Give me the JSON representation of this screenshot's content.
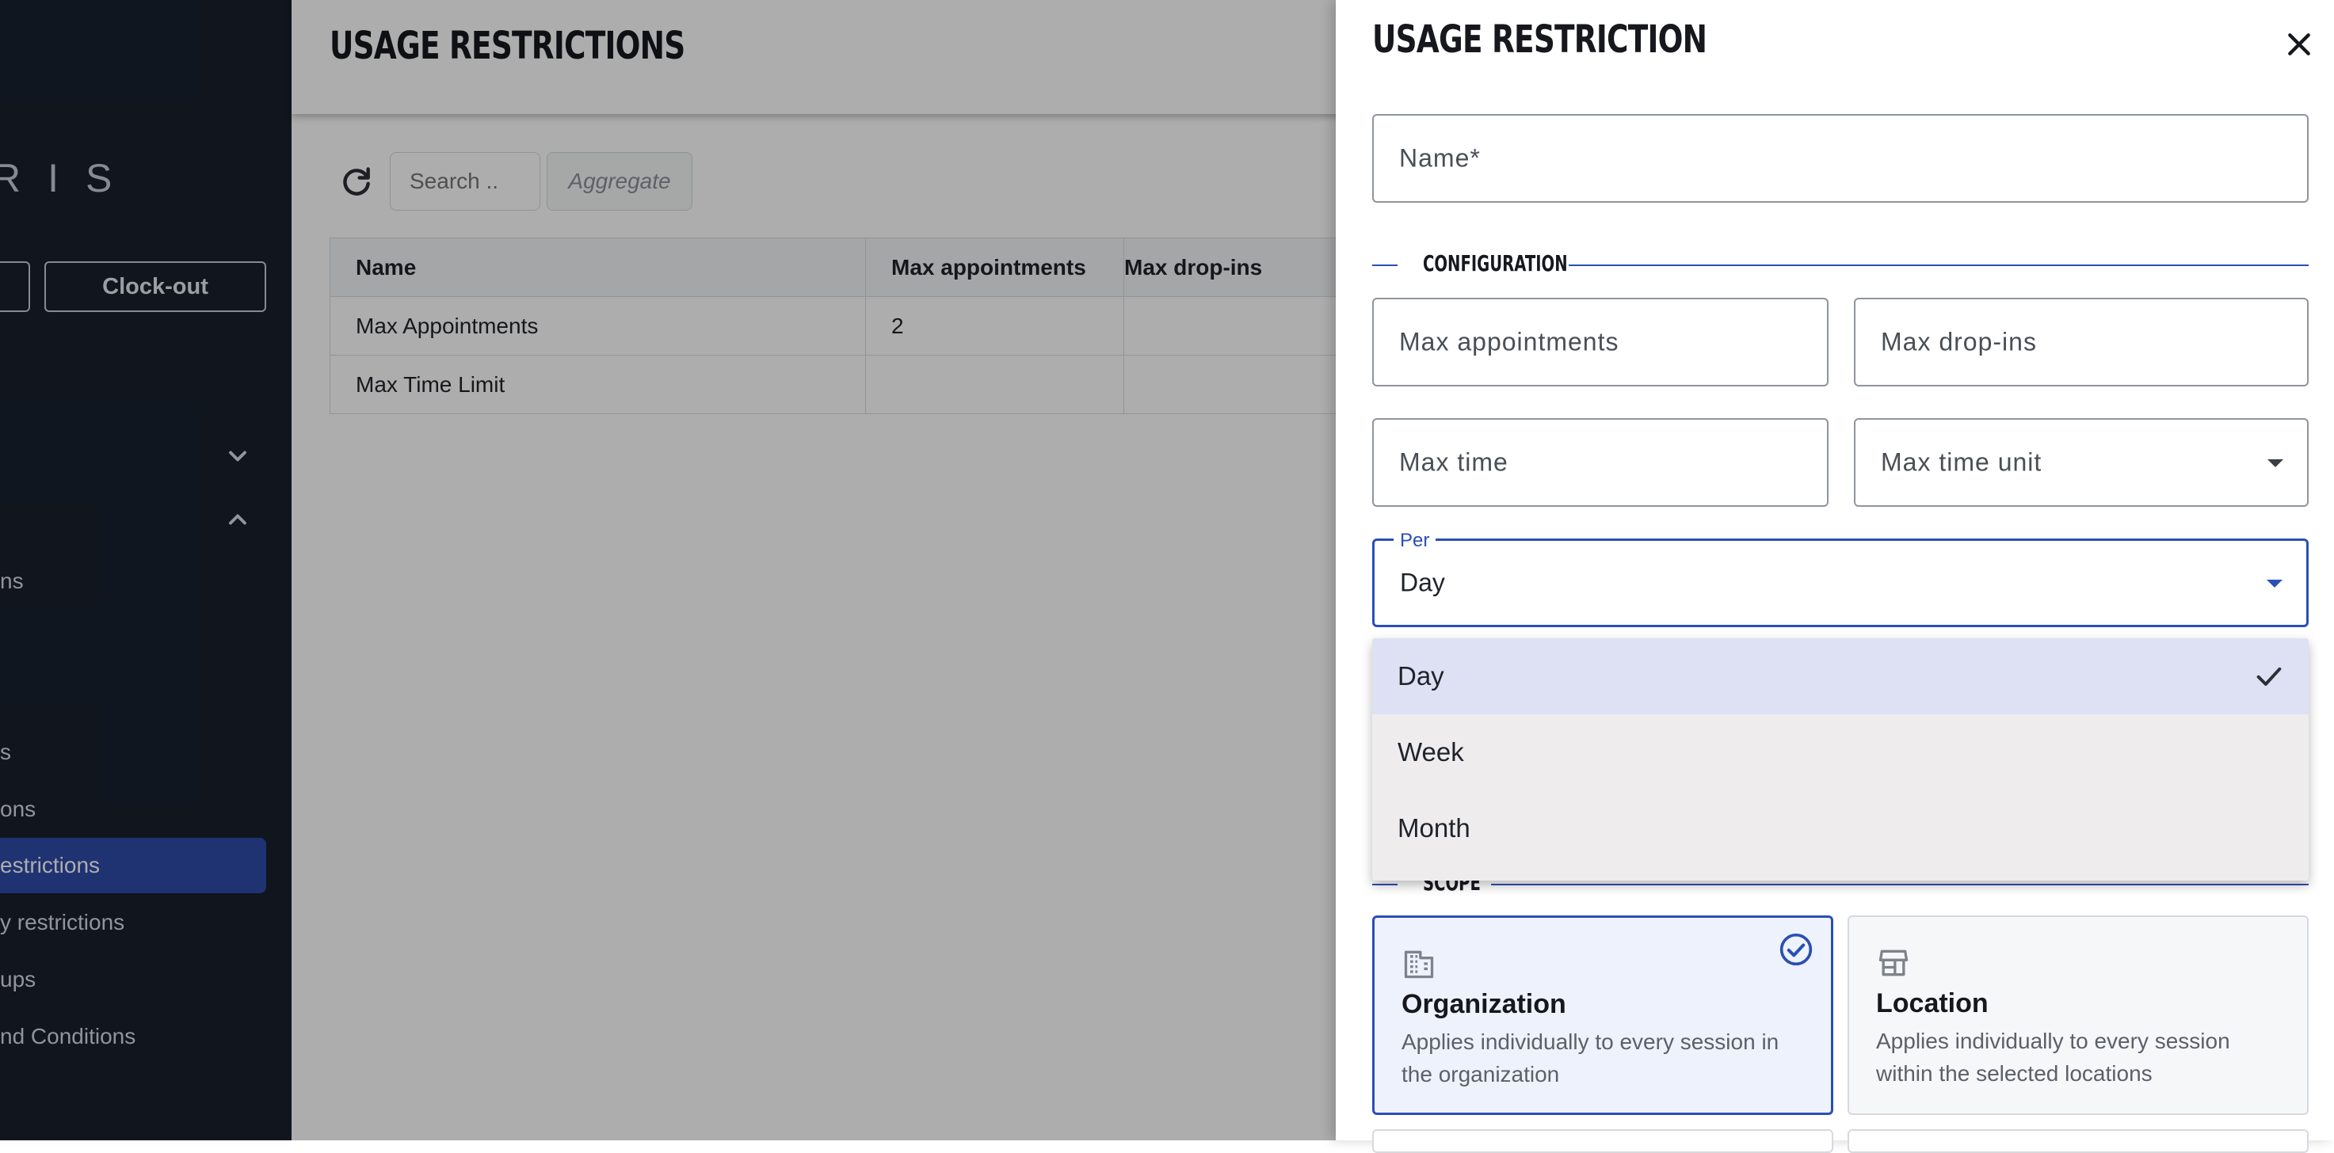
{
  "sidebar": {
    "logo": "RIS",
    "clockout_label": "Clock-out",
    "items": [
      {
        "label": "ns"
      },
      {
        "label": "s"
      },
      {
        "label": "ons"
      },
      {
        "label": "estrictions"
      },
      {
        "label": "y restrictions"
      },
      {
        "label": "ups"
      },
      {
        "label": "nd Conditions"
      }
    ]
  },
  "page": {
    "title": "USAGE RESTRICTIONS",
    "search_placeholder": "Search ..",
    "aggregate_label": "Aggregate",
    "table": {
      "headers": [
        "Name",
        "Max appointments",
        "Max drop-ins"
      ],
      "rows": [
        [
          "Max Appointments",
          "2",
          ""
        ],
        [
          "Max Time Limit",
          "",
          ""
        ]
      ]
    }
  },
  "drawer": {
    "title": "USAGE RESTRICTION",
    "name_placeholder": "Name*",
    "config_section": "CONFIGURATION",
    "max_appointments_placeholder": "Max appointments",
    "max_dropins_placeholder": "Max drop-ins",
    "max_time_placeholder": "Max time",
    "max_time_unit_placeholder": "Max time unit",
    "per_label": "Per",
    "per_value": "Day",
    "per_options": [
      "Day",
      "Week",
      "Month"
    ],
    "scope_section": "SCOPE",
    "scope_cards": [
      {
        "title": "Organization",
        "description": "Applies individually to every session in the organization",
        "selected": true
      },
      {
        "title": "Location",
        "description": "Applies individually to every session within the selected locations",
        "selected": false
      }
    ]
  },
  "colors": {
    "accent": "#2a4fb5",
    "sidebar_bg": "#18202d",
    "sidebar_active": "#2e4aa8"
  }
}
